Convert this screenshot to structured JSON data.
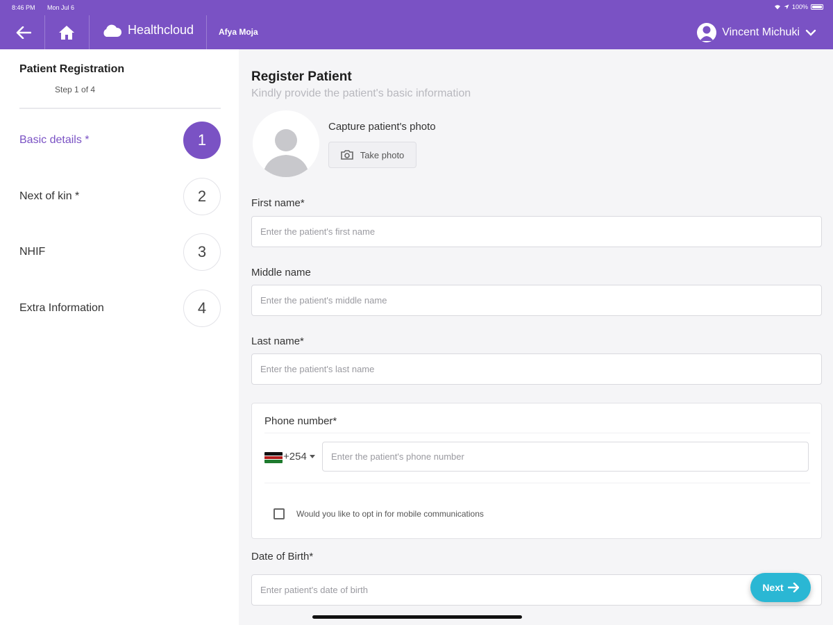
{
  "status": {
    "time": "8:46 PM",
    "date": "Mon Jul 6",
    "battery": "100%"
  },
  "app": {
    "brand": "Healthcloud",
    "org": "Afya Moja",
    "user": "Vincent Michuki",
    "accent": "#7a52c4",
    "cta_color": "#2ab7d4"
  },
  "sidebar": {
    "title": "Patient Registration",
    "subtitle": "Step 1 of 4",
    "steps": [
      {
        "label": "Basic details *",
        "number": "1"
      },
      {
        "label": "Next of kin *",
        "number": "2"
      },
      {
        "label": "NHIF",
        "number": "3"
      },
      {
        "label": "Extra Information",
        "number": "4"
      }
    ]
  },
  "main": {
    "title": "Register Patient",
    "subtitle": "Kindly provide the patient's basic information",
    "photo_label": "Capture patient's photo",
    "take_photo": "Take photo",
    "fields": {
      "first_name": {
        "label": "First name*",
        "placeholder": "Enter the patient's first name"
      },
      "middle_name": {
        "label": "Middle name",
        "placeholder": "Enter the patient's middle name"
      },
      "last_name": {
        "label": "Last name*",
        "placeholder": "Enter the patient's last name"
      },
      "dob": {
        "label": "Date of Birth*",
        "placeholder": "Enter patient's date of birth"
      }
    },
    "phone": {
      "label": "Phone number*",
      "dial_code": "+254",
      "placeholder": "Enter the patient's phone number",
      "opt_in": "Would you like to opt in for mobile communications"
    },
    "next": "Next"
  }
}
